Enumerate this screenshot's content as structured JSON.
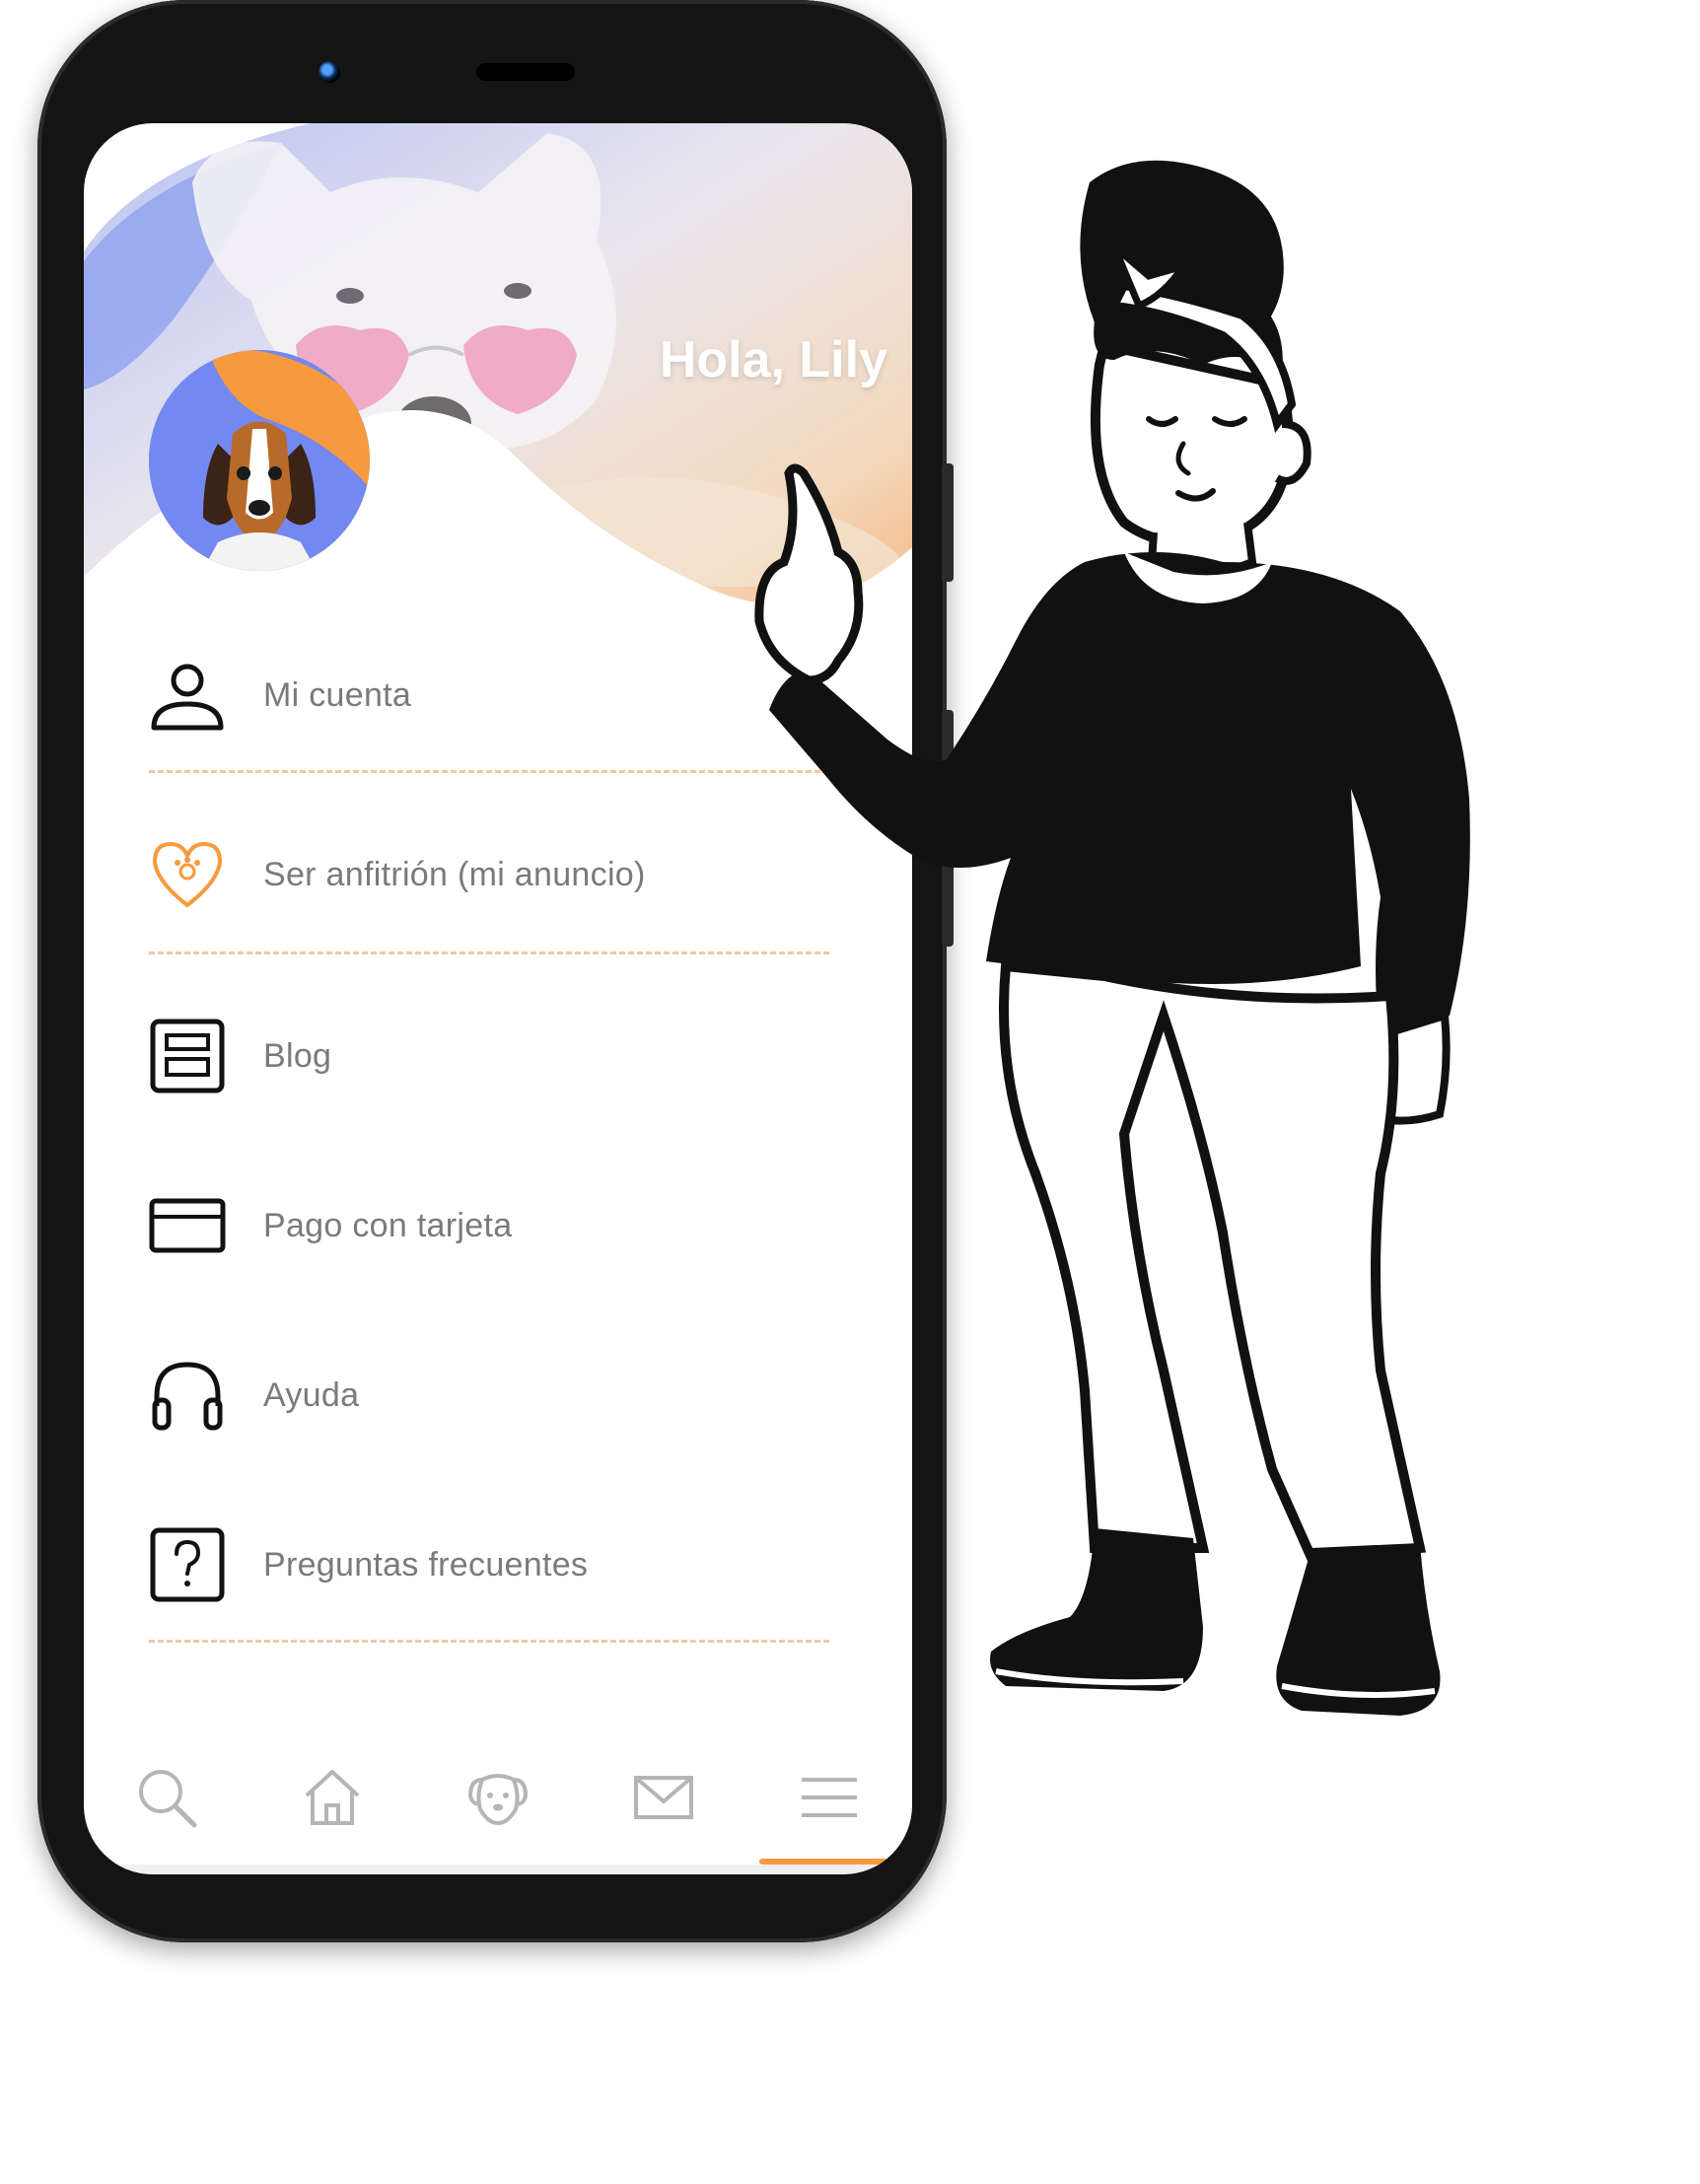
{
  "greeting": "Hola, Lily",
  "menu": {
    "items": [
      {
        "label": "Mi cuenta",
        "icon": "person-icon"
      },
      {
        "label": "Ser anfitrión (mi anuncio)",
        "icon": "heart-paw-icon"
      },
      {
        "label": "Blog",
        "icon": "blog-layout-icon"
      },
      {
        "label": "Pago con tarjeta",
        "icon": "credit-card-icon"
      },
      {
        "label": "Ayuda",
        "icon": "headphones-icon"
      },
      {
        "label": "Preguntas frecuentes",
        "icon": "question-box-icon"
      }
    ]
  },
  "bottom_nav": {
    "items": [
      "search-icon",
      "home-icon",
      "dog-icon",
      "mail-icon",
      "menu-icon"
    ],
    "active": "menu-icon"
  },
  "colors": {
    "accent_orange": "#f79a3e",
    "accent_purple": "#7388f0",
    "divider": "#f0c9a2",
    "label_gray": "#7a7a7a",
    "nav_gray": "#b5b5b5"
  }
}
